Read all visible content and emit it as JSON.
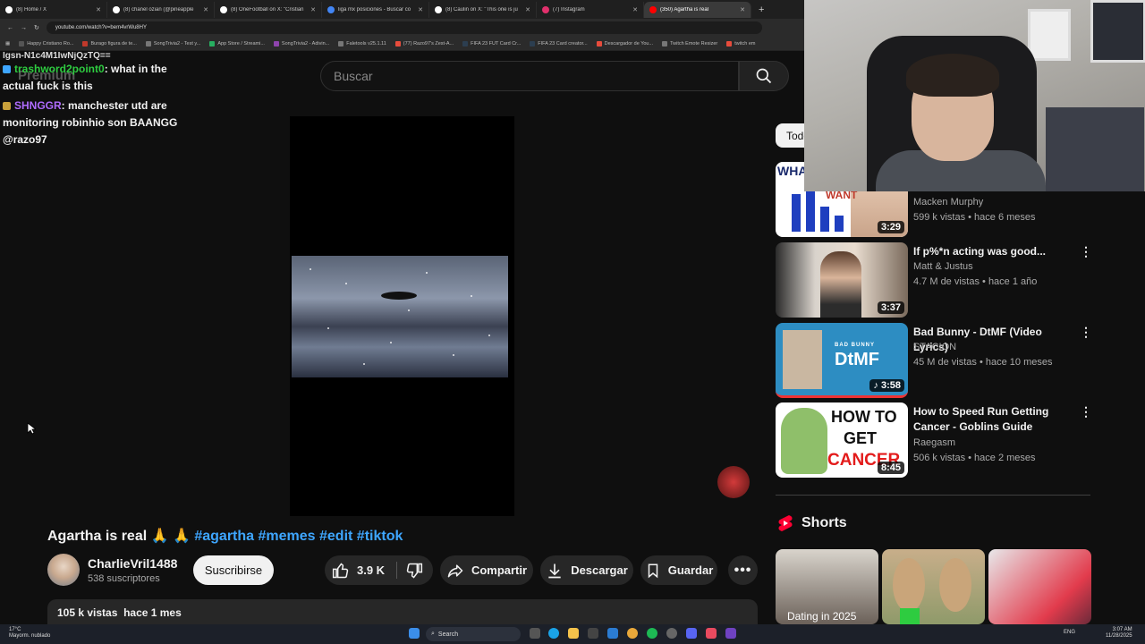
{
  "browser": {
    "tabs": [
      {
        "title": "(8) Home / X",
        "color": "#ffffff"
      },
      {
        "title": "(8) chanel ozian (@pineapple",
        "color": "#ffffff"
      },
      {
        "title": "(8) OneFootball on X: \"Cristian",
        "color": "#ffffff"
      },
      {
        "title": "liga mx posiciones - Buscar co",
        "color": "#4285f4"
      },
      {
        "title": "(8) Caulin on X: \"This one is ju",
        "color": "#ffffff"
      },
      {
        "title": "(7) Instagram",
        "color": "#e1306c"
      },
      {
        "title": "(350) Agartha is real",
        "color": "#ff0000"
      }
    ],
    "url": "youtube.com/watch?v=bem4vrWu8HY",
    "bookmarks": [
      {
        "label": "Happy Cristiano Ro...",
        "color": "#555"
      },
      {
        "label": "Burago figura de te...",
        "color": "#c0392b"
      },
      {
        "label": "SongTrivia2 - Test y...",
        "color": "#777"
      },
      {
        "label": "App Store / Streami...",
        "color": "#27ae60"
      },
      {
        "label": "SongTrivia2 - Adivin...",
        "color": "#8e44ad"
      },
      {
        "label": "Faletools v25.1.11",
        "color": "#777"
      },
      {
        "label": "(77) Razo97's Zest-A...",
        "color": "#e74c3c"
      },
      {
        "label": "FIFA 23 FUT Card Cr...",
        "color": "#2c3e50"
      },
      {
        "label": "FIFA 23 Card creator...",
        "color": "#2c3e50"
      },
      {
        "label": "Descargador de You...",
        "color": "#e74c3c"
      },
      {
        "label": "Twitch Emote Resizer",
        "color": "#777"
      },
      {
        "label": "twitch em",
        "color": "#e74c3c"
      }
    ]
  },
  "chat": {
    "partial_top": "lgsn-N1c4M1IwNjQzTQ==",
    "messages": [
      {
        "user": "trashword2point0",
        "user_color": "#2ecc40",
        "text": ": what in the actual fuck is this",
        "badge_color": "#3ea6ff"
      },
      {
        "user": "SHNGGR",
        "user_color": "#b06cff",
        "text": ": manchester utd are monitoring robinhio son BAANGG @razo97",
        "badge_color": "#c9a13b"
      }
    ]
  },
  "youtube": {
    "logo_text": "Premium",
    "search_placeholder": "Buscar",
    "video_title_plain": "Agartha is real 🙏 🙏",
    "hashtags": [
      "#agartha",
      "#memes",
      "#edit",
      "#tiktok"
    ],
    "channel_name": "CharlieVril1488",
    "subscribers": "538 suscriptores",
    "subscribe_label": "Suscribirse",
    "like_count": "3.9 K",
    "share_label": "Compartir",
    "download_label": "Descargar",
    "save_label": "Guardar",
    "views": "105 k vistas",
    "uploaded": "hace 1 mes",
    "chip_label": "Todo",
    "shorts_label": "Shorts",
    "recommendations": [
      {
        "title": "",
        "channel": "Macken Murphy",
        "meta": "599 k vistas • hace 6 meses",
        "duration": "3:29"
      },
      {
        "title": "If p%*n acting was good...",
        "channel": "Matt & Justus",
        "meta": "4.7 M de vistas • hace 1 año",
        "duration": "3:37"
      },
      {
        "title": "Bad Bunny - DtMF (Video Lyrics)",
        "channel": "STACION",
        "meta": "45 M de vistas • hace 10 meses",
        "duration": "3:58"
      },
      {
        "title": "How to Speed Run Getting Cancer - Goblins Guide",
        "channel": "Raegasm",
        "meta": "506 k vistas • hace 2 meses",
        "duration": "8:45"
      }
    ],
    "thumb_texts": {
      "r1": "WHA",
      "r1b": "WANT",
      "r3_artist": "BAD BUNNY",
      "r3_title": "DtMF",
      "r4_line1": "HOW TO",
      "r4_line2": "GET",
      "r4_line3": "CANCER"
    },
    "shorts": [
      {
        "title": "Dating in 2025"
      },
      {
        "title": ""
      },
      {
        "title": ""
      }
    ]
  },
  "taskbar": {
    "temp": "17°C",
    "weather": "Mayorm. nublado",
    "search": "Search",
    "lang": "ENG",
    "time": "3:07 AM",
    "date": "11/28/2025"
  }
}
